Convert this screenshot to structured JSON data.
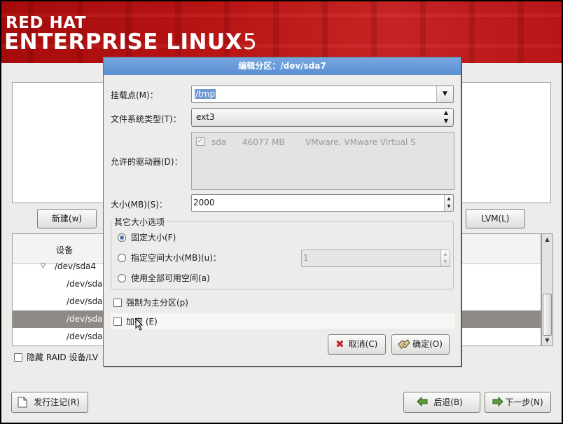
{
  "banner": {
    "line1": "RED HAT",
    "line2": "ENTERPRISE LINUX",
    "version": "5"
  },
  "main": {
    "new_button": "新建(w)",
    "lvm_button": "LVM(L)",
    "device_header": "设备",
    "devices": [
      "/dev/sda4",
      "/dev/sda",
      "/dev/sda",
      "/dev/sda",
      "/dev/sda"
    ],
    "hide_raid_label": "隐藏 RAID 设备/LV",
    "release_notes_button": "发行注记(R)",
    "back_button": "后退(B)",
    "next_button": "下一步(N)"
  },
  "dialog": {
    "title": "编辑分区：/dev/sda7",
    "mount_label": "挂载点(M)：",
    "mount_value": "/tmp",
    "fstype_label": "文件系统类型(T)：",
    "fstype_value": "ext3",
    "drives_label": "允许的驱动器(D)：",
    "drive": {
      "name": "sda",
      "size": "46077 MB",
      "model": "VMware, VMware Virtual S"
    },
    "size_label": "大小(MB)(S)：",
    "size_value": "2000",
    "options_group_label": "其它大小选项",
    "opt_fixed": "固定大小(F)",
    "opt_upto": "指定空间大小(MB)(u)：",
    "opt_upto_value": "1",
    "opt_fill": "使用全部可用空间(a)",
    "force_primary": "强制为主分区(p)",
    "encrypt": "加密 (E)",
    "cancel_button": "取消(C)",
    "ok_button": "确定(O)"
  },
  "colors": {
    "banner_red": "#b91515",
    "title_blue": "#5b8fd2",
    "selection_blue": "#6d98d4"
  }
}
